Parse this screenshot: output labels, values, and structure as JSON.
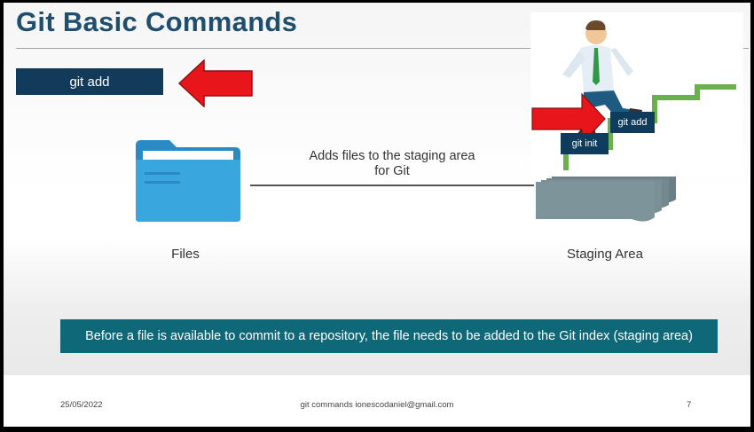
{
  "slide": {
    "title": "Git Basic Commands",
    "command": "git add",
    "files_label": "Files",
    "caption_line1": "Adds files to the staging area",
    "caption_line2": "for Git",
    "staging_label": "Staging Area",
    "banner": "Before a file is available to commit to a repository, the file needs to be added to the Git index (staging area)"
  },
  "footer": {
    "date": "25/05/2022",
    "center": "git commands ionescodaniel@gmail.com",
    "page": "7"
  },
  "inset": {
    "step_upper": "git add",
    "step_lower": "git init"
  },
  "colors": {
    "title": "#1f4e6e",
    "command_box": "#123a5a",
    "arrow": "#e8161b",
    "folder": "#3aa6de",
    "banner": "#0f6878",
    "stairs": "#6ab04c"
  },
  "icons": {
    "folder": "folder-icon",
    "staging": "stacked-pages-icon",
    "pointer": "red-arrow-icon"
  }
}
